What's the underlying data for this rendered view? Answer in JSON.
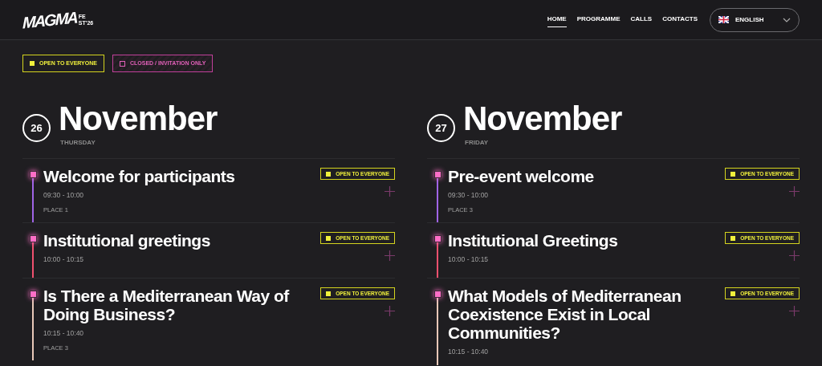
{
  "logo": {
    "wordmark": "MAGMA",
    "tag_top": "FE",
    "tag_bottom": "ST'26"
  },
  "nav": [
    {
      "label": "HOME",
      "selected": true
    },
    {
      "label": "PROGRAMME",
      "selected": false
    },
    {
      "label": "CALLS",
      "selected": false
    },
    {
      "label": "CONTACTS",
      "selected": false
    }
  ],
  "language": {
    "label": "ENGLISH"
  },
  "legend": [
    {
      "kind": "open",
      "label": "OPEN TO EVERYONE"
    },
    {
      "kind": "closed",
      "label": "CLOSED / INVITATION ONLY"
    }
  ],
  "days": [
    {
      "day": "26",
      "month": "November",
      "weekday": "THURSDAY",
      "events": [
        {
          "title": "Welcome for participants",
          "time": "09:30 - 10:00",
          "place": "PLACE 1",
          "kind": "open",
          "badge": "OPEN TO EVERYONE",
          "color": "#a064e6"
        },
        {
          "title": "Institutional greetings",
          "time": "10:00 - 10:15",
          "kind": "open",
          "badge": "OPEN TO EVERYONE",
          "color": "#f0506e"
        },
        {
          "title": "Is There a Mediterranean Way of Doing Business?",
          "time": "10:15 - 10:40",
          "place": "PLACE 3",
          "kind": "open",
          "badge": "OPEN TO EVERYONE",
          "color": "#e8c8b8"
        }
      ]
    },
    {
      "day": "27",
      "month": "November",
      "weekday": "FRIDAY",
      "events": [
        {
          "title": "Pre-event welcome",
          "time": "09:30 - 10:00",
          "place": "PLACE 3",
          "kind": "open",
          "badge": "OPEN TO EVERYONE",
          "color": "#a064e6"
        },
        {
          "title": "Institutional Greetings",
          "time": "10:00 - 10:15",
          "kind": "open",
          "badge": "OPEN TO EVERYONE",
          "color": "#f0506e"
        },
        {
          "title": "What Models of Mediterranean Coexistence Exist in Local Communities?",
          "time": "10:15 - 10:40",
          "kind": "open",
          "badge": "OPEN TO EVERYONE",
          "color": "#e8c8b8"
        }
      ]
    }
  ]
}
